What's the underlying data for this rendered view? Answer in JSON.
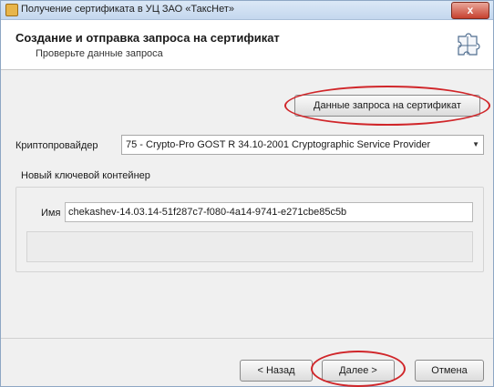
{
  "window": {
    "title": "Получение сертификата в УЦ ЗАО «ТаксНет»",
    "close_label": "x"
  },
  "header": {
    "title": "Создание и отправка запроса на сертификат",
    "subtitle": "Проверьте данные запроса"
  },
  "request_data_button": "Данные запроса на сертификат",
  "crypto_provider": {
    "label": "Криптопровайдер",
    "value": "75 - Crypto-Pro GOST R 34.10-2001 Cryptographic Service Provider"
  },
  "container_group": {
    "title": "Новый ключевой контейнер",
    "name_label": "Имя",
    "name_value": "chekashev-14.03.14-51f287c7-f080-4a14-9741-e271cbe85c5b"
  },
  "footer": {
    "back_label": "< Назад",
    "next_label": "Далее >",
    "cancel_label": "Отмена"
  },
  "colors": {
    "highlight": "#d0262a"
  },
  "icons": [
    "window-icon",
    "certificate-puzzle-icon",
    "dropdown-arrow-icon"
  ]
}
